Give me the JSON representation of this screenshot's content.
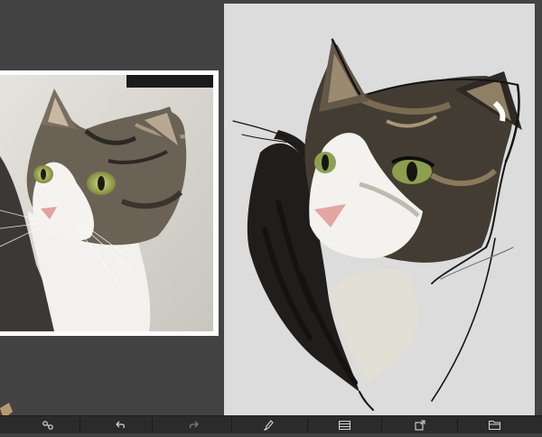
{
  "app": {
    "accent_color": "#d4d4d4",
    "canvas_color": "#dcdcdc",
    "background_color": "#434343"
  },
  "reference": {
    "image_subject": "tabby-white-cat-photo"
  },
  "canvas": {
    "image_subject": "cat-painting-in-progress"
  },
  "toolbar": {
    "icons": [
      "brush-settings-icon",
      "undo-icon",
      "redo-icon",
      "brush-icon",
      "layers-icon",
      "transform-icon",
      "folder-icon"
    ]
  }
}
